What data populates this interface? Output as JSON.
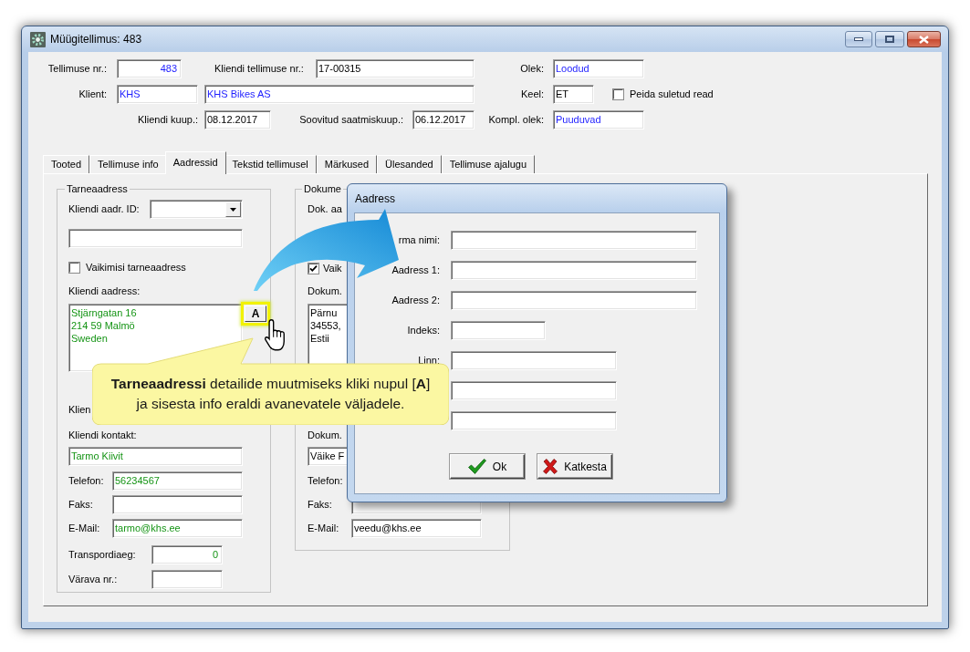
{
  "window": {
    "title": "Müügitellimus: 483"
  },
  "header": {
    "order_no": {
      "label": "Tellimuse nr.:",
      "value": "483"
    },
    "customer_order_no": {
      "label": "Kliendi tellimuse nr.:",
      "value": "17-00315"
    },
    "status": {
      "label": "Olek:",
      "value": "Loodud"
    },
    "client": {
      "label": "Klient:",
      "code": "KHS",
      "name": "KHS Bikes AS"
    },
    "language": {
      "label": "Keel:",
      "value": "ET"
    },
    "hide_closed_rows": {
      "label": "Peida suletud read",
      "checked": false
    },
    "client_date": {
      "label": "Kliendi kuup.:",
      "value": "08.12.2017"
    },
    "requested_ship_date": {
      "label": "Soovitud saatmiskuup.:",
      "value": "06.12.2017"
    },
    "completion_status": {
      "label": "Kompl. olek:",
      "value": "Puuduvad"
    }
  },
  "tabs": [
    {
      "label": "Tooted",
      "selected": false
    },
    {
      "label": "Tellimuse info",
      "selected": false
    },
    {
      "label": "Aadressid",
      "selected": true
    },
    {
      "label": "Tekstid tellimusel",
      "selected": false
    },
    {
      "label": "Märkused",
      "selected": false
    },
    {
      "label": "Ülesanded",
      "selected": false
    },
    {
      "label": "Tellimuse ajalugu",
      "selected": false
    }
  ],
  "delivery_address": {
    "title": "Tarneaadress",
    "address_id_label": "Kliendi aadr. ID:",
    "default_address": {
      "label": "Vaikimisi tarneaadress",
      "checked": false
    },
    "address_label": "Kliendi aadress:",
    "address": "Stjärngatan 16\n214 59 Malmö\nSweden",
    "edit_button": "A",
    "covered_label": "Klien",
    "contact_label": "Kliendi kontakt:",
    "contact": "Tarmo Kiivit",
    "phone": {
      "label": "Telefon:",
      "value": "56234567"
    },
    "fax": {
      "label": "Faks:"
    },
    "email": {
      "label": "E-Mail:",
      "value": "tarmo@khs.ee"
    },
    "transport_time": {
      "label": "Transpordiaeg:",
      "value": "0"
    },
    "gate_no": {
      "label": "Värava nr.:"
    }
  },
  "document_address": {
    "title": "Dokume",
    "address_id_label": "Dok. aa",
    "default_address": {
      "label": "Vaik",
      "checked": true
    },
    "address_label": "Dokum.",
    "address": "Pärnu\n34553,\nEstii",
    "contact_label": "Dokum.",
    "contact": "Väike F",
    "phone": {
      "label": "Telefon:"
    },
    "fax": {
      "label": "Faks:"
    },
    "email": {
      "label": "E-Mail:",
      "value": "veedu@khs.ee"
    }
  },
  "dialog": {
    "title": "Aadress",
    "fields": [
      {
        "kind": "input",
        "label": "rma nimi:"
      },
      {
        "kind": "input",
        "label": "Aadress 1:"
      },
      {
        "kind": "input",
        "label": "Aadress 2:"
      },
      {
        "kind": "input",
        "label": "Indeks:"
      },
      {
        "kind": "input",
        "label": "Linn:"
      },
      {
        "kind": "input"
      },
      {
        "kind": "input"
      }
    ],
    "buttons": [
      {
        "kind": "ok",
        "label": "Ok"
      },
      {
        "kind": "cancel",
        "label": "Katkesta"
      }
    ]
  },
  "callout": {
    "text": "**Tarneaadressi** detailide muutmiseks kliki nupul [**A**]\nja sisesta info eraldi avanevatele väljadele."
  }
}
